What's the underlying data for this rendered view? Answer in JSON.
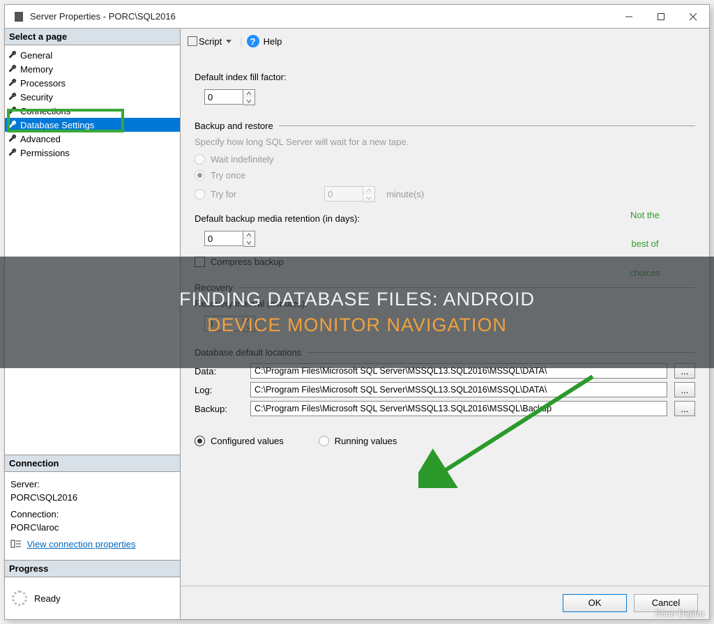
{
  "window": {
    "title": "Server Properties - PORC\\SQL2016"
  },
  "sidebar": {
    "header": "Select a page",
    "items": [
      {
        "label": "General"
      },
      {
        "label": "Memory"
      },
      {
        "label": "Processors"
      },
      {
        "label": "Security"
      },
      {
        "label": "Connections"
      },
      {
        "label": "Database Settings",
        "selected": true
      },
      {
        "label": "Advanced"
      },
      {
        "label": "Permissions"
      }
    ]
  },
  "connection": {
    "header": "Connection",
    "server_label": "Server:",
    "server_value": "PORC\\SQL2016",
    "conn_label": "Connection:",
    "conn_value": "PORC\\laroc",
    "link": "View connection properties"
  },
  "progress": {
    "header": "Progress",
    "status": "Ready"
  },
  "toolbar": {
    "script": "Script",
    "help": "Help"
  },
  "content": {
    "fill_label": "Default index fill factor:",
    "fill_value": "0",
    "backup_header": "Backup and restore",
    "backup_help": "Specify how long SQL Server will wait for a new tape.",
    "opt_wait": "Wait indefinitely",
    "opt_tryonce": "Try once",
    "opt_tryfor": "Try for",
    "tryfor_value": "0",
    "tryfor_unit": "minute(s)",
    "media_label": "Default backup media retention (in days):",
    "media_value": "0",
    "compress": "Compress backup",
    "recovery_header": "Recovery",
    "recovery_label": "Recovery interval (minutes):",
    "recovery_value": "0",
    "locations_header": "Database default locations",
    "data_label": "Data:",
    "data_value": "C:\\Program Files\\Microsoft SQL Server\\MSSQL13.SQL2016\\MSSQL\\DATA\\",
    "log_label": "Log:",
    "log_value": "C:\\Program Files\\Microsoft SQL Server\\MSSQL13.SQL2016\\MSSQL\\DATA\\",
    "backup_label": "Backup:",
    "backup_value": "C:\\Program Files\\Microsoft SQL Server\\MSSQL13.SQL2016\\MSSQL\\Backup",
    "configured": "Configured values",
    "running": "Running values"
  },
  "buttons": {
    "ok": "OK",
    "cancel": "Cancel"
  },
  "overlay": {
    "line1": "FINDING DATABASE FILES: ANDROID",
    "line2": "DEVICE MONITOR NAVIGATION"
  },
  "annotation": "Not the\nbest of\nchoices",
  "watermark": "Shun Digital"
}
